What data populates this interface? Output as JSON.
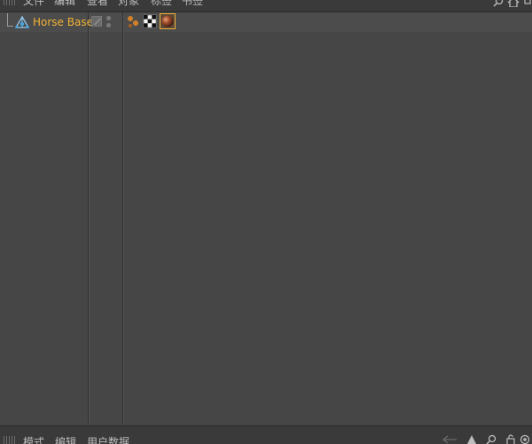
{
  "menubar": {
    "items": [
      "文件",
      "编辑",
      "查看",
      "对象",
      "标签",
      "书签"
    ],
    "tools": [
      "search-icon",
      "home-icon"
    ]
  },
  "object": {
    "name": "Horse Base",
    "icon": "null-object-icon",
    "tags": [
      "polygon-selection-tag-icon",
      "texture-checker-tag-icon",
      "material-tag-icon"
    ]
  },
  "attributes_bar": {
    "items": [
      "模式",
      "编辑",
      "用户数据"
    ],
    "tools": [
      "back-arrow-icon",
      "up-arrow-icon",
      "search-icon",
      "lock-icon",
      "settings-icon"
    ]
  },
  "colors": {
    "background": "#464646",
    "selected_text": "#f2b134",
    "menubar": "#3a3a3a"
  }
}
